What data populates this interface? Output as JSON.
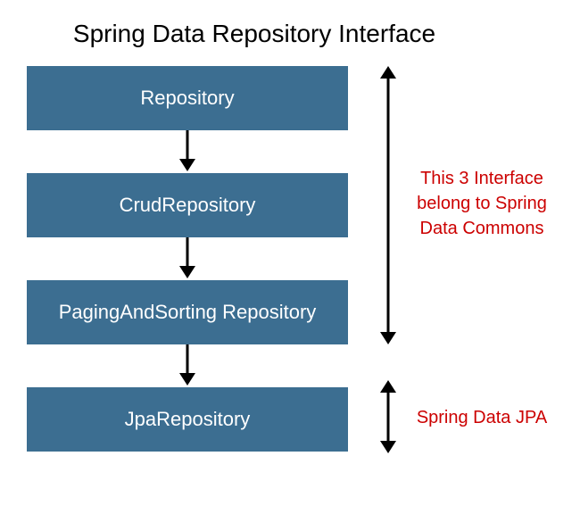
{
  "title": "Spring Data Repository Interface",
  "boxes": {
    "b1": "Repository",
    "b2": "CrudRepository",
    "b3": "PagingAndSorting Repository",
    "b4": "JpaRepository"
  },
  "annotations": {
    "commons": "This 3 Interface belong to Spring Data Commons",
    "jpa": "Spring Data JPA"
  },
  "colors": {
    "box_bg": "#3c6e91",
    "box_text": "#ffffff",
    "annotation_text": "#cc0000"
  }
}
